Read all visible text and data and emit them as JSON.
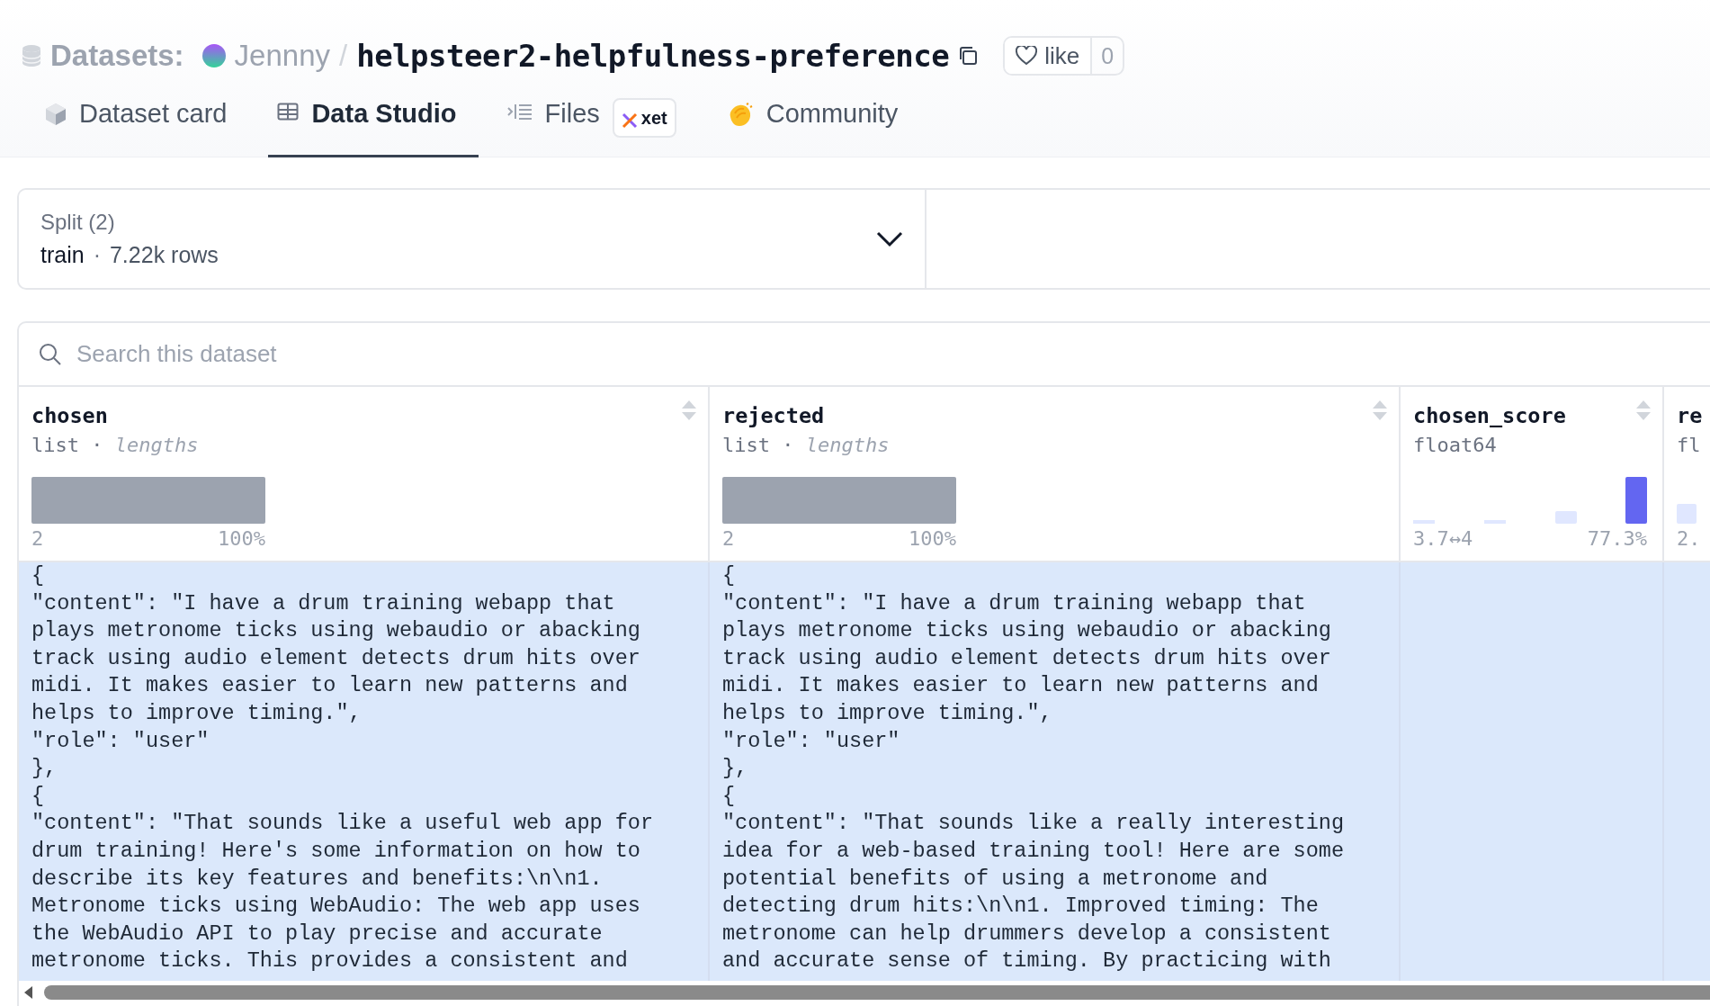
{
  "breadcrumb": {
    "section": "Datasets:",
    "owner": "Jennny",
    "separator": "/",
    "name": "helpsteer2-helpfulness-preference"
  },
  "like": {
    "label": "like",
    "count": "0"
  },
  "tabs": [
    {
      "label": "Dataset card",
      "selected": false
    },
    {
      "label": "Data Studio",
      "selected": true
    },
    {
      "label": "Files",
      "badge": "xet",
      "selected": false
    },
    {
      "label": "Community",
      "selected": false
    }
  ],
  "split": {
    "label": "Split (2)",
    "value": "train",
    "separator": "·",
    "rows": "7.22k rows"
  },
  "search": {
    "placeholder": "Search this dataset"
  },
  "table": {
    "columns": [
      {
        "name": "chosen",
        "type": "list · *lengths*",
        "kind": "lengths",
        "min": "2",
        "share": "100%"
      },
      {
        "name": "rejected",
        "type": "list · *lengths*",
        "kind": "lengths",
        "min": "2",
        "share": "100%"
      },
      {
        "name": "chosen_score",
        "type": "float64",
        "kind": "histogram",
        "min": "3.7↔4",
        "share": "77.3%"
      },
      {
        "name": "re",
        "type": "fl",
        "kind": "histogram",
        "min": "2."
      }
    ],
    "rows": [
      {
        "selected": true,
        "cells": [
          "{\n\"content\": \"I have a drum training webapp that\nplays metronome ticks using webaudio or abacking\ntrack using audio element detects drum hits over\nmidi. It makes easier to learn new patterns and\nhelps to improve timing.\",\n\"role\": \"user\"\n},\n{\n\"content\": \"That sounds like a useful web app for\ndrum training! Here's some information on how to\ndescribe its key features and benefits:\\n\\n1.\nMetronome ticks using WebAudio: The web app uses\nthe WebAudio API to play precise and accurate\nmetronome ticks. This provides a consistent and",
          "{\n\"content\": \"I have a drum training webapp that\nplays metronome ticks using webaudio or abacking\ntrack using audio element detects drum hits over\nmidi. It makes easier to learn new patterns and\nhelps to improve timing.\",\n\"role\": \"user\"\n},\n{\n\"content\": \"That sounds like a really interesting\nidea for a web-based training tool! Here are some\npotential benefits of using a metronome and\ndetecting drum hits:\\n\\n1. Improved timing: The\nmetronome can help drummers develop a consistent\nand accurate sense of timing. By practicing with"
        ]
      }
    ]
  }
}
